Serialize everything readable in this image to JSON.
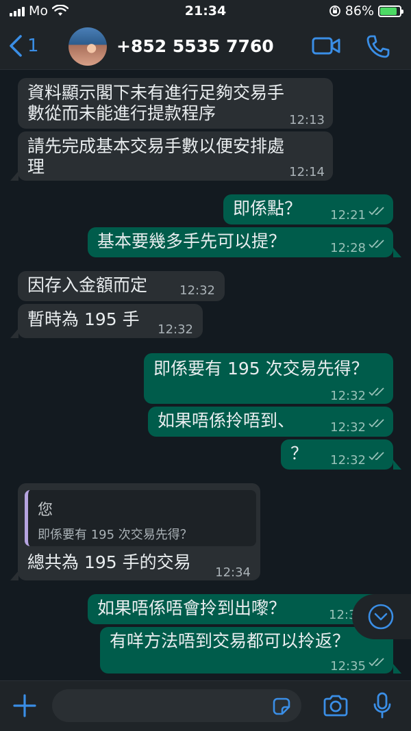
{
  "status_bar": {
    "carrier": "Mo",
    "time": "21:34",
    "battery_pct": "86%",
    "battery_level": 0.86
  },
  "header": {
    "back_count": "1",
    "contact": "+852 5535 7760"
  },
  "messages": [
    {
      "dir": "in",
      "line1": "資料顯示閣下未有進行足夠交易手",
      "line2": "數從而未能進行提款程序",
      "time": "12:13"
    },
    {
      "dir": "in",
      "line1": "請先完成基本交易手數以便安排處",
      "line2": "理",
      "time": "12:14"
    },
    {
      "dir": "out",
      "line1": "即係點？",
      "time": "12:21"
    },
    {
      "dir": "out",
      "line1": "基本要幾多手先可以提？",
      "time": "12:28"
    },
    {
      "dir": "in",
      "line1": "因存入金額而定",
      "time": "12:32"
    },
    {
      "dir": "in",
      "line1": "暫時為 195 手",
      "time": "12:32"
    },
    {
      "dir": "out",
      "line1": "即係要有 195 次交易先得？",
      "time": "12:32"
    },
    {
      "dir": "out",
      "line1": "如果唔係拎唔到、",
      "time": "12:32"
    },
    {
      "dir": "out",
      "line1": "？",
      "time": "12:32"
    },
    {
      "dir": "in",
      "quote_author": "您",
      "quote_text": "即係要有 195 次交易先得？",
      "line1": "總共為 195 手的交易",
      "time": "12:34"
    },
    {
      "dir": "out",
      "line1": "如果唔係唔會拎到出嚟？",
      "time": "12:3"
    },
    {
      "dir": "out",
      "line1": "有咩方法唔到交易都可以拎返？",
      "time": "12:35"
    }
  ],
  "input": {
    "value": "",
    "placeholder": ""
  },
  "icons": {
    "back": "chevron-left-icon",
    "video": "video-call-icon",
    "phone": "phone-icon",
    "add": "plus-icon",
    "sticker": "sticker-icon",
    "camera": "camera-icon",
    "mic": "microphone-icon",
    "scroll": "chevron-down-circle-icon"
  },
  "colors": {
    "accent": "#3a8ee6",
    "incoming_bubble": "#2a2f33",
    "outgoing_bubble": "#005c4b",
    "background": "#131a20",
    "read_ticks": "#99c2b9"
  }
}
